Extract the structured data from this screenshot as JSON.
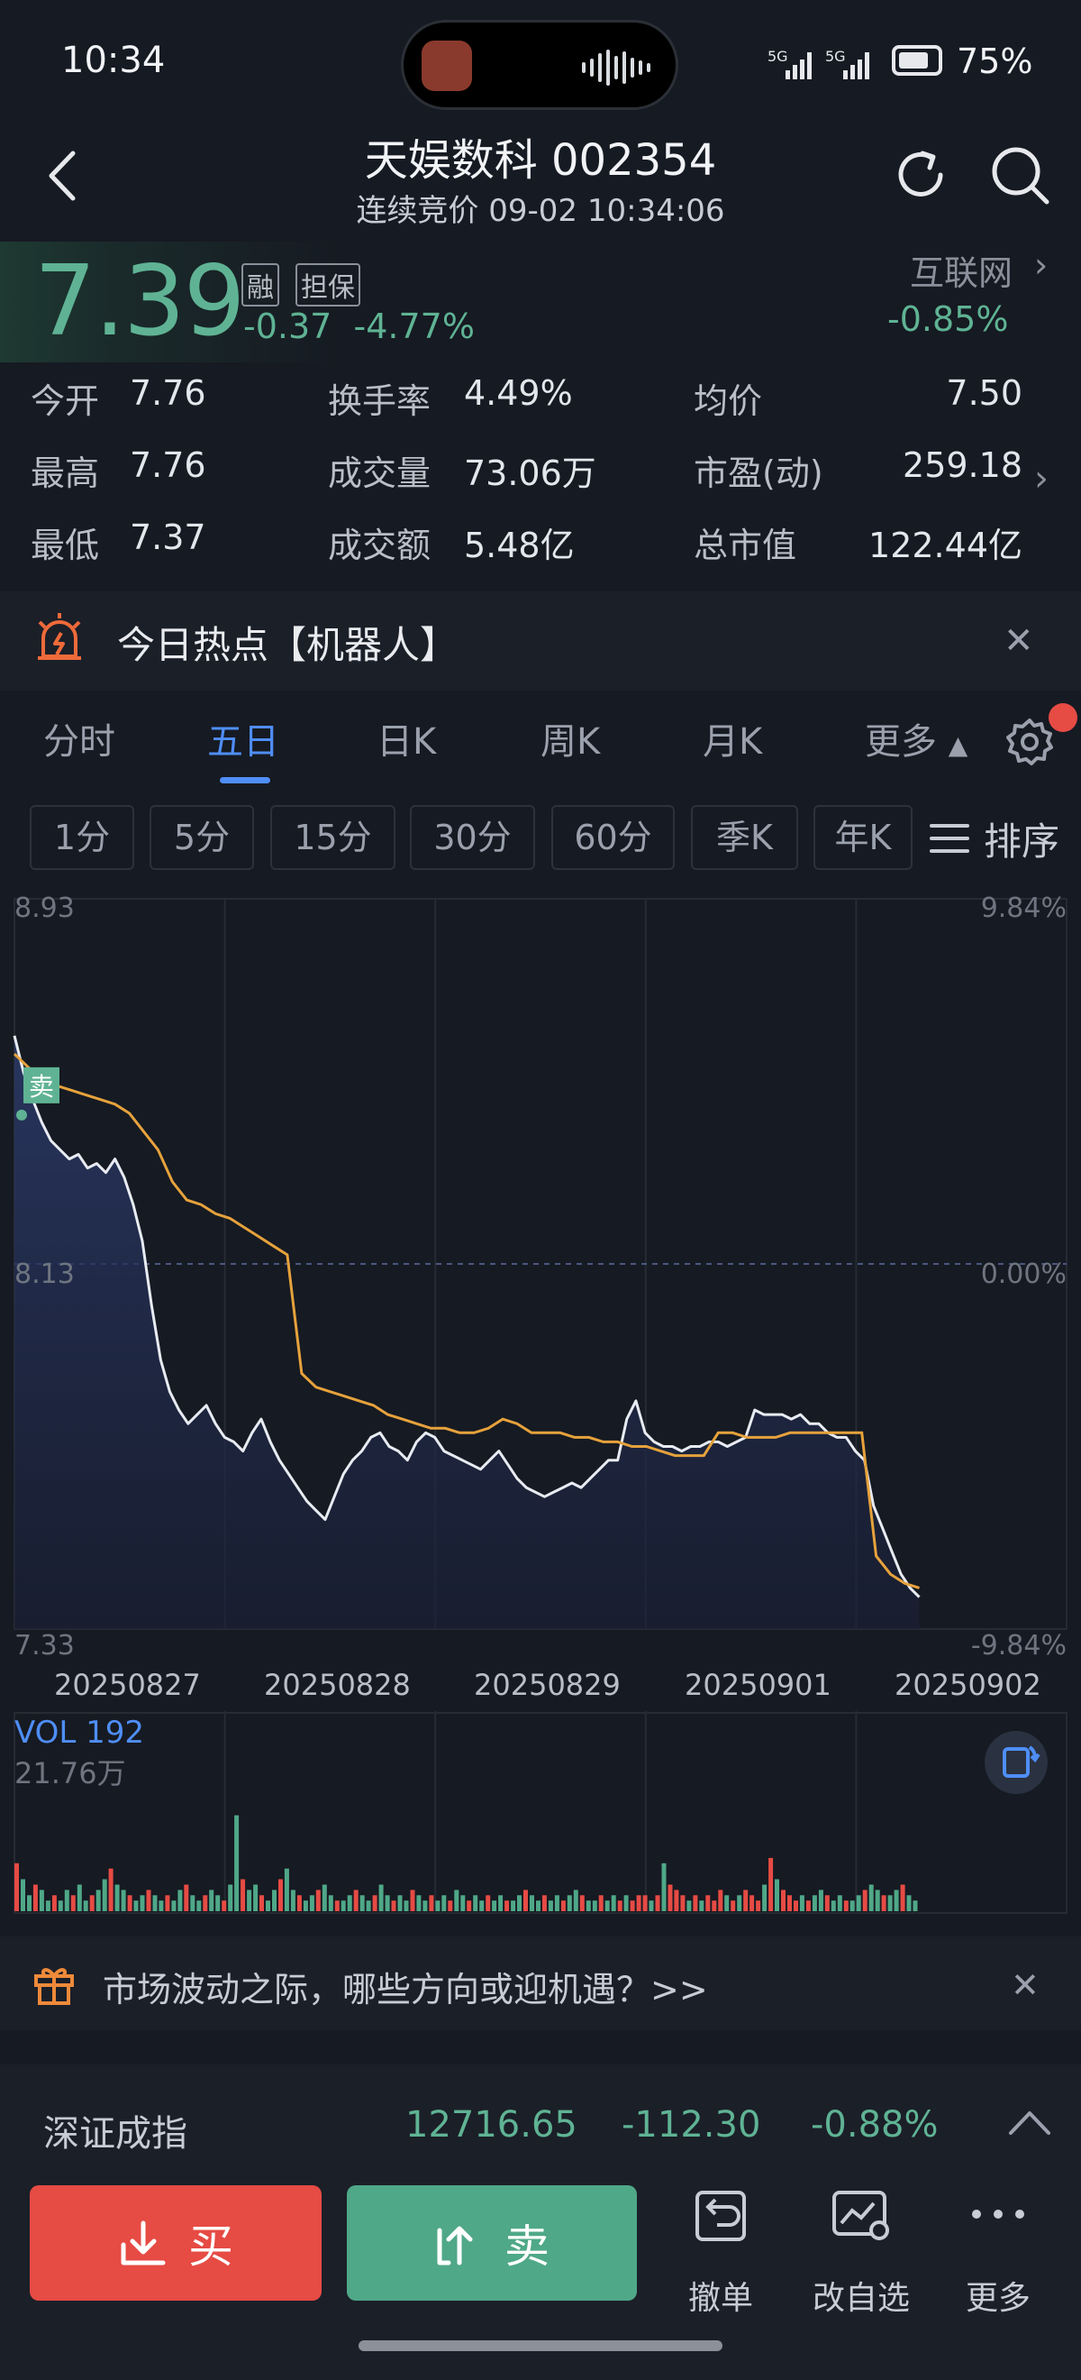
{
  "status_bar": {
    "time": "10:34",
    "battery": "75%",
    "signal_1": "5G",
    "signal_2": "5G"
  },
  "header": {
    "title": "天娱数科 002354",
    "subtitle": "连续竞价 09-02 10:34:06"
  },
  "quote": {
    "price": "7.39",
    "badge_1": "融",
    "badge_2": "担保",
    "change": "-0.37",
    "change_pct": "-4.77%",
    "sector_name": "互联网",
    "sector_change": "-0.85%"
  },
  "stats": {
    "open_label": "今开",
    "open": "7.76",
    "turnover_label": "换手率",
    "turnover": "4.49%",
    "avg_label": "均价",
    "avg": "7.50",
    "high_label": "最高",
    "high": "7.76",
    "volume_label": "成交量",
    "volume": "73.06万",
    "pe_label": "市盈(动)",
    "pe": "259.18",
    "low_label": "最低",
    "low": "7.37",
    "amount_label": "成交额",
    "amount": "5.48亿",
    "mcap_label": "总市值",
    "mcap": "122.44亿"
  },
  "hot_topic": {
    "text": "今日热点【机器人】"
  },
  "tabs": [
    "分时",
    "五日",
    "日K",
    "周K",
    "月K",
    "更多"
  ],
  "intervals": [
    "1分",
    "5分",
    "15分",
    "30分",
    "60分",
    "季K",
    "年K"
  ],
  "sort_label": "排序",
  "chart_data": {
    "type": "line",
    "title": "",
    "y_ticks_left": [
      "8.93",
      "8.13",
      "7.33"
    ],
    "y_ticks_right": [
      "9.84%",
      "0.00%",
      "-9.84%"
    ],
    "ylim": [
      7.33,
      8.93
    ],
    "prev_close": 8.13,
    "x_labels": [
      "20250827",
      "20250828",
      "20250829",
      "20250901",
      "20250902"
    ],
    "sell_marker": "卖",
    "series": [
      {
        "values": [
          8.63,
          8.55,
          8.49,
          8.44,
          8.4,
          8.38,
          8.36,
          8.37,
          8.34,
          8.35,
          8.33,
          8.36,
          8.32,
          8.26,
          8.18,
          8.04,
          7.92,
          7.85,
          7.81,
          7.78,
          7.8,
          7.82,
          7.78,
          7.75,
          7.74,
          7.72,
          7.76,
          7.79,
          7.74,
          7.7,
          7.67,
          7.64,
          7.61,
          7.59,
          7.57,
          7.62,
          7.67,
          7.7,
          7.72,
          7.75,
          7.76,
          7.73,
          7.72,
          7.7,
          7.74,
          7.76,
          7.75,
          7.72,
          7.71,
          7.7,
          7.69,
          7.68,
          7.7,
          7.72,
          7.69,
          7.66,
          7.64,
          7.63,
          7.62,
          7.63,
          7.64,
          7.65,
          7.64,
          7.66,
          7.68,
          7.7,
          7.7,
          7.79,
          7.83,
          7.76,
          7.74,
          7.73,
          7.73,
          7.72,
          7.73,
          7.73,
          7.74,
          7.74,
          7.73,
          7.74,
          7.75,
          7.81,
          7.8,
          7.8,
          7.8,
          7.79,
          7.8,
          7.78,
          7.78,
          7.76,
          7.75,
          7.75,
          7.72,
          7.7,
          7.6,
          7.55,
          7.5,
          7.45,
          7.42,
          7.4
        ]
      },
      {
        "values": [
          8.59,
          8.56,
          8.53,
          8.52,
          8.51,
          8.5,
          8.49,
          8.48,
          8.46,
          8.42,
          8.38,
          8.31,
          8.27,
          8.26,
          8.24,
          8.23,
          8.21,
          8.19,
          8.17,
          8.15,
          7.89,
          7.86,
          7.85,
          7.84,
          7.83,
          7.82,
          7.8,
          7.79,
          7.78,
          7.77,
          7.77,
          7.76,
          7.76,
          7.77,
          7.79,
          7.78,
          7.76,
          7.76,
          7.76,
          7.75,
          7.75,
          7.74,
          7.74,
          7.73,
          7.73,
          7.72,
          7.71,
          7.71,
          7.71,
          7.76,
          7.76,
          7.75,
          7.75,
          7.75,
          7.76,
          7.76,
          7.76,
          7.76,
          7.76,
          7.76,
          7.49,
          7.45,
          7.43,
          7.42
        ]
      }
    ]
  },
  "volume": {
    "label": "VOL 192",
    "max_label": "21.76万",
    "values": [
      9,
      6,
      3,
      5,
      4,
      2,
      3,
      2,
      4,
      3,
      5,
      2,
      3,
      4,
      6,
      8,
      5,
      4,
      3,
      2,
      3,
      4,
      3,
      2,
      3,
      2,
      4,
      5,
      3,
      2,
      3,
      4,
      3,
      2,
      5,
      18,
      6,
      4,
      5,
      3,
      2,
      4,
      6,
      8,
      4,
      3,
      2,
      3,
      4,
      5,
      3,
      2,
      2,
      3,
      4,
      3,
      2,
      3,
      5,
      3,
      2,
      3,
      2,
      4,
      3,
      2,
      3,
      2,
      3,
      2,
      4,
      3,
      2,
      3,
      2,
      3,
      2,
      3,
      2,
      2,
      3,
      4,
      3,
      2,
      3,
      2,
      3,
      2,
      3,
      4,
      3,
      2,
      2,
      3,
      2,
      3,
      2,
      3,
      2,
      3,
      3,
      2,
      3,
      9,
      5,
      4,
      3,
      2,
      3,
      2,
      3,
      2,
      4,
      3,
      2,
      3,
      4,
      3,
      2,
      5,
      10,
      6,
      4,
      3,
      2,
      3,
      2,
      3,
      4,
      3,
      2,
      3,
      2,
      2,
      3,
      4,
      5,
      4,
      3,
      3,
      4,
      5,
      3,
      2
    ]
  },
  "promo": {
    "text": "市场波动之际，哪些方向或迎机遇？>>"
  },
  "index": {
    "name": "深证成指",
    "value": "12716.65",
    "change": "-112.30",
    "pct": "-0.88%"
  },
  "bottom": {
    "buy_label": "买",
    "sell_label": "卖",
    "cancel_label": "撤单",
    "watchlist_label": "改自选",
    "more_label": "更多"
  },
  "colors": {
    "up": "#e64b44",
    "down": "#5fb394",
    "accent": "#4f8ef7",
    "avg_line": "#e6a23c"
  }
}
